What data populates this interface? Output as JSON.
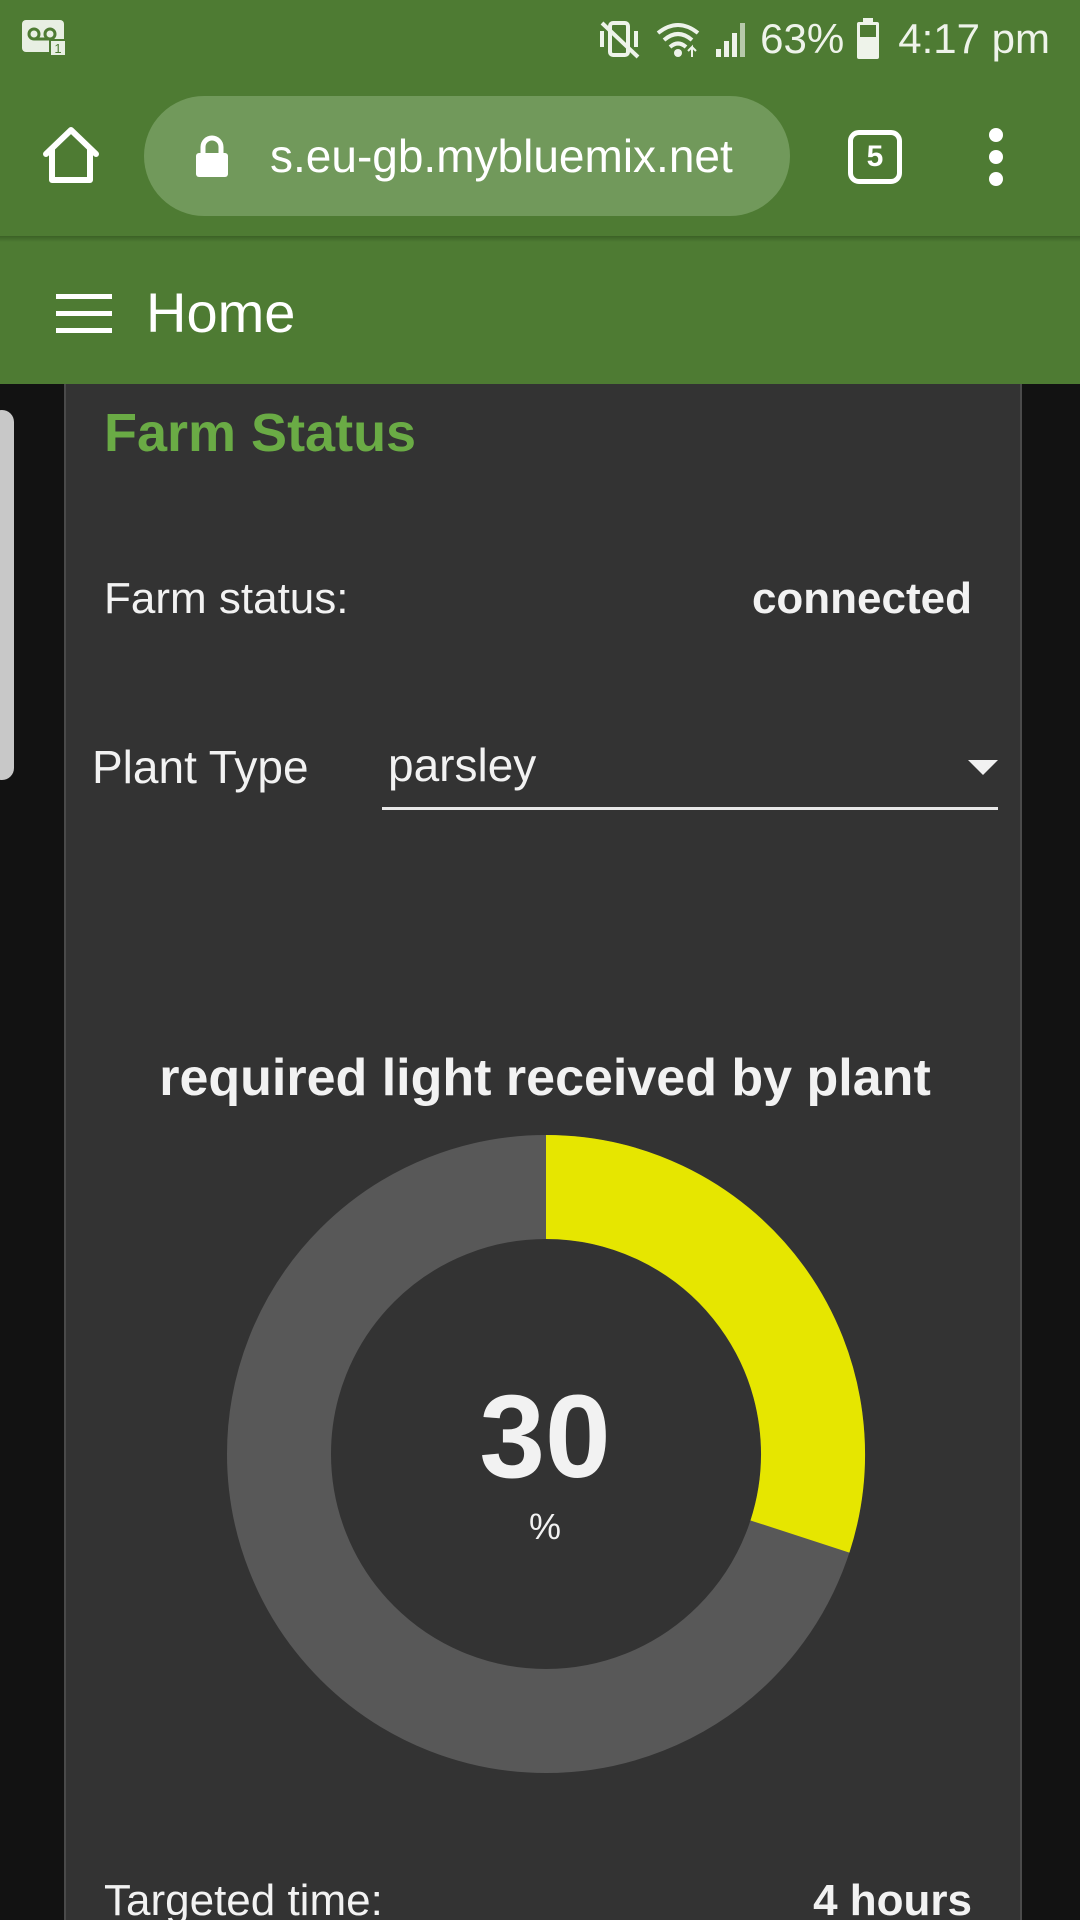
{
  "status_bar": {
    "battery": "63%",
    "time": "4:17 pm",
    "icons": [
      "voicemail-icon",
      "mute-vibrate-icon",
      "wifi-icon",
      "signal-icon",
      "battery-icon"
    ]
  },
  "browser": {
    "url": "s.eu-gb.mybluemix.net",
    "tab_count": "5",
    "toolbar_color": "#4e7b33"
  },
  "app_bar": {
    "title": "Home"
  },
  "card": {
    "title": "Farm Status",
    "farm_status_label": "Farm status:",
    "farm_status_value": "connected",
    "plant_type_label": "Plant Type",
    "plant_type_value": "parsley",
    "targeted_time_label": "Targeted time:",
    "targeted_time_value": "4 hours"
  },
  "chart_data": {
    "type": "pie",
    "title": "required light received by plant",
    "value": 30,
    "value_label": "30",
    "unit": "%",
    "max": 100,
    "colors": {
      "filled": "#e6e600",
      "remaining": "#585858"
    }
  }
}
